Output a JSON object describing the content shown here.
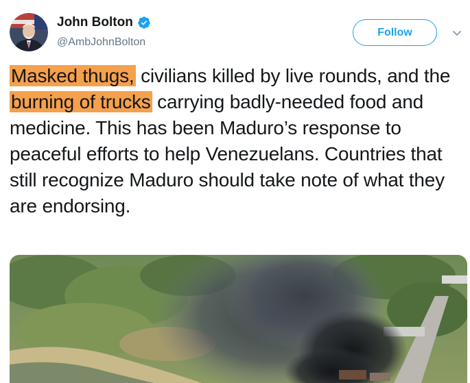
{
  "author": {
    "display_name": "John Bolton",
    "handle": "@AmbJohnBolton",
    "verified": true,
    "avatar_icon": "profile-photo"
  },
  "actions": {
    "follow_label": "Follow",
    "menu_icon": "chevron-down-icon"
  },
  "tweet": {
    "highlight_1": "Masked thugs,",
    "text_1": " civilians killed by live rounds, and the ",
    "highlight_2": "burning of trucks",
    "text_2": " carrying badly-needed food and medicine. This has been Maduro’s response to peaceful efforts to help Venezuelans. Countries that still recognize Maduro should take note of what they are endorsing.",
    "highlight_color": "#f5a04d"
  },
  "media": {
    "type": "photo",
    "icon": "aerial-photo-burning-trucks"
  },
  "colors": {
    "accent": "#1da1f2",
    "text": "#14171a",
    "muted": "#657786"
  }
}
